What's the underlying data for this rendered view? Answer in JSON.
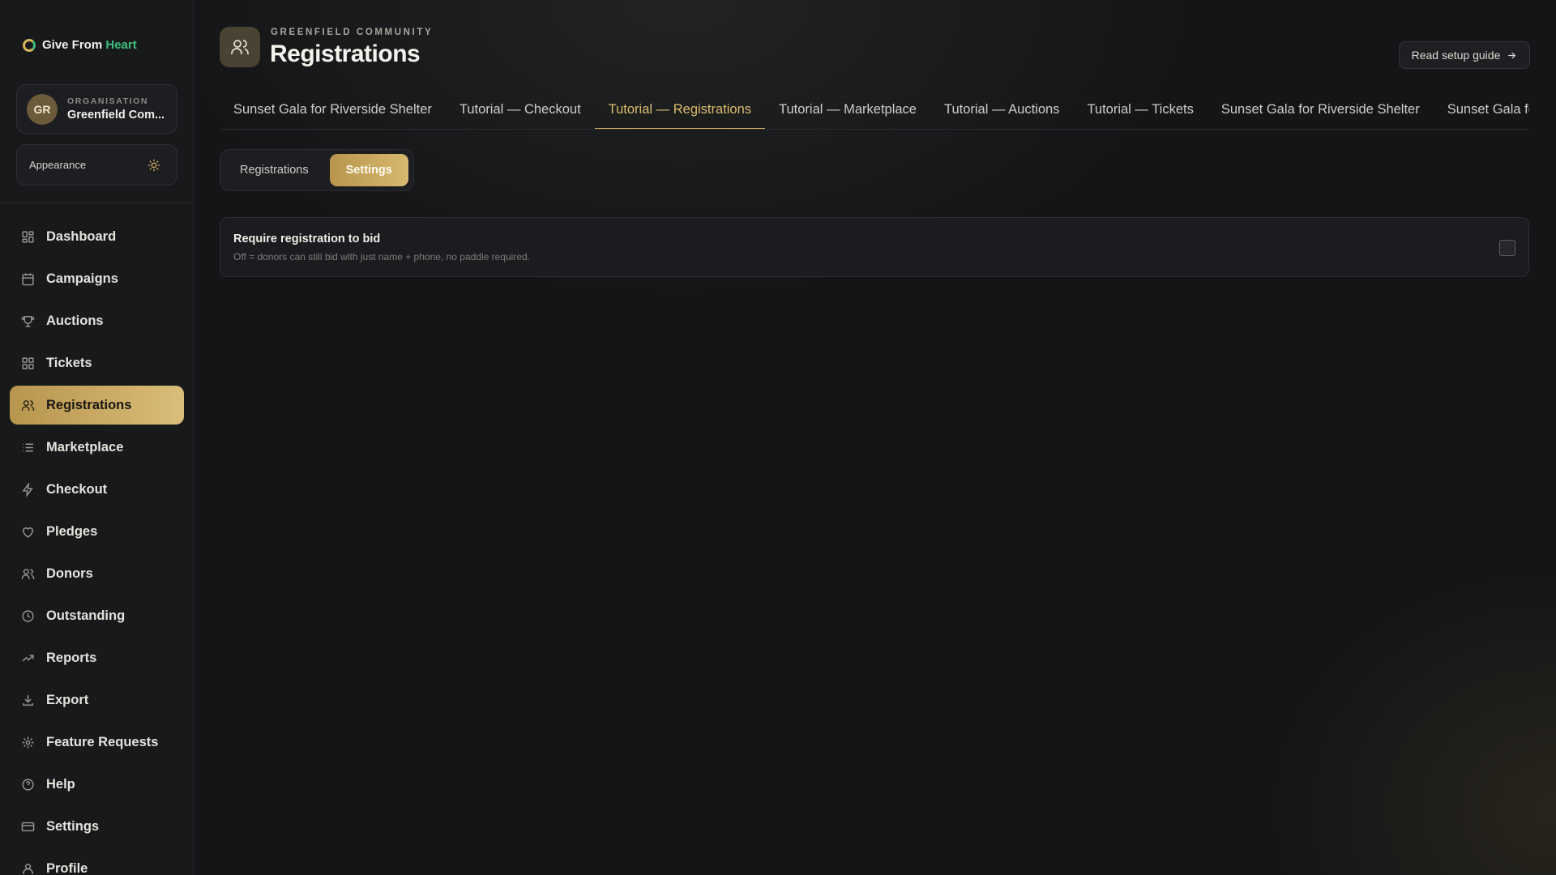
{
  "brand": {
    "name_part1": "Give From",
    "name_part2": "Heart"
  },
  "organisation": {
    "kicker": "ORGANISATION",
    "initials": "GR",
    "name": "Greenfield Com..."
  },
  "appearance": {
    "label": "Appearance",
    "icon": "sun-icon"
  },
  "nav": {
    "items": [
      {
        "label": "Dashboard",
        "icon": "grid-icon"
      },
      {
        "label": "Campaigns",
        "icon": "calendar-icon"
      },
      {
        "label": "Auctions",
        "icon": "trophy-icon"
      },
      {
        "label": "Tickets",
        "icon": "ticket-icon"
      },
      {
        "label": "Registrations",
        "icon": "users-icon",
        "active": true
      },
      {
        "label": "Marketplace",
        "icon": "list-icon"
      },
      {
        "label": "Checkout",
        "icon": "bolt-icon"
      },
      {
        "label": "Pledges",
        "icon": "heart-icon"
      },
      {
        "label": "Donors",
        "icon": "users-icon"
      },
      {
        "label": "Outstanding",
        "icon": "clock-icon"
      },
      {
        "label": "Reports",
        "icon": "trend-icon"
      },
      {
        "label": "Export",
        "icon": "download-icon"
      },
      {
        "label": "Feature Requests",
        "icon": "sparkle-icon"
      },
      {
        "label": "Help",
        "icon": "help-icon"
      },
      {
        "label": "Settings",
        "icon": "card-icon"
      },
      {
        "label": "Profile",
        "icon": "user-icon"
      }
    ]
  },
  "header": {
    "kicker": "GREENFIELD COMMUNITY",
    "title": "Registrations",
    "guide_button": "Read setup guide"
  },
  "campaign_tabs": [
    {
      "label": "Sunset Gala for Riverside Shelter"
    },
    {
      "label": "Tutorial — Checkout"
    },
    {
      "label": "Tutorial — Registrations",
      "active": true
    },
    {
      "label": "Tutorial — Marketplace"
    },
    {
      "label": "Tutorial — Auctions"
    },
    {
      "label": "Tutorial — Tickets"
    },
    {
      "label": "Sunset Gala for Riverside Shelter"
    },
    {
      "label": "Sunset Gala for Riverside Shelter"
    }
  ],
  "sub_tabs": {
    "registrations": "Registrations",
    "settings": "Settings",
    "active": "settings"
  },
  "settings": {
    "require_registration": {
      "title": "Require registration to bid",
      "description": "Off = donors can still bid with just name + phone, no paddle required.",
      "checked": false
    }
  },
  "colors": {
    "accent_gold": "#d3b060",
    "brand_green": "#3fbf7f",
    "background": "#141517"
  }
}
